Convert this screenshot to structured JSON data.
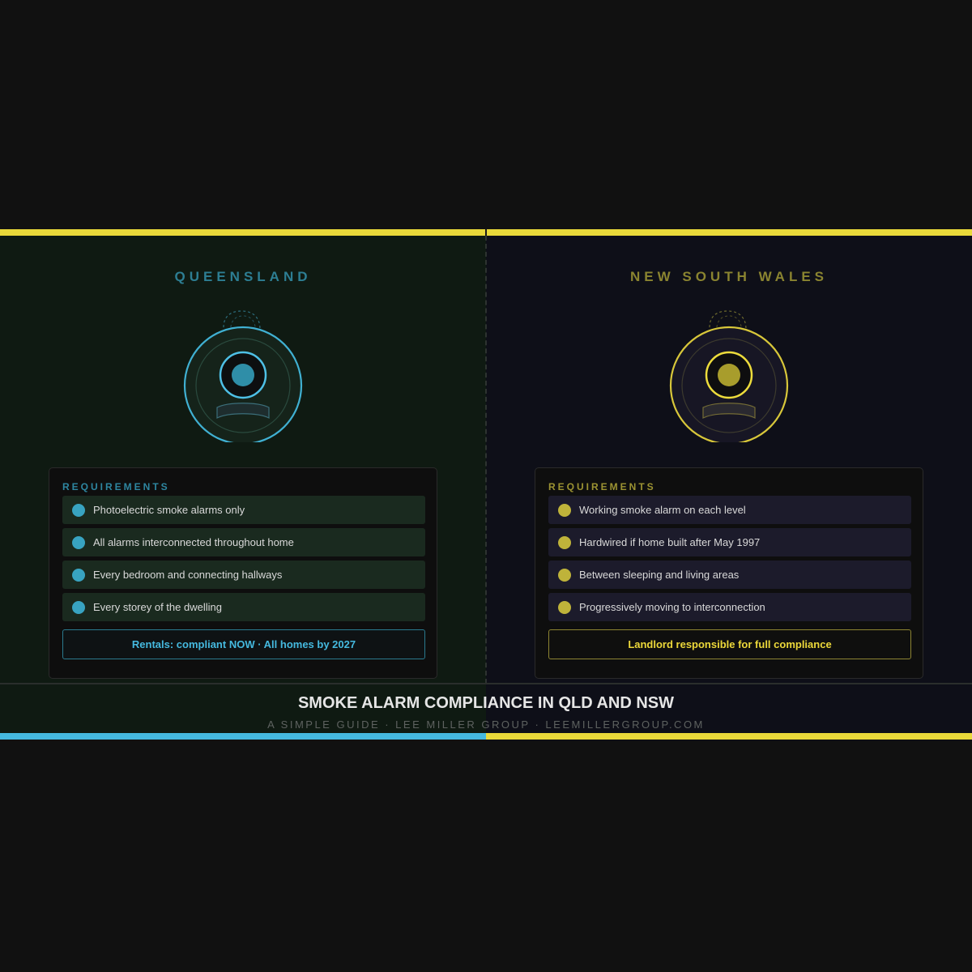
{
  "qld": {
    "title": "QUEENSLAND",
    "requirements_heading": "REQUIREMENTS",
    "requirements": [
      "Photoelectric smoke alarms only",
      "All alarms interconnected throughout home",
      "Every bedroom and connecting hallways",
      "Every storey of the dwelling"
    ],
    "callout": "Rentals: compliant NOW · All homes by 2027",
    "accent": "#45b9df"
  },
  "nsw": {
    "title": "NEW SOUTH WALES",
    "requirements_heading": "REQUIREMENTS",
    "requirements": [
      "Working smoke alarm on each level",
      "Hardwired if home built after May 1997",
      "Between sleeping and living areas",
      "Progressively moving to interconnection"
    ],
    "callout": "Landlord responsible for full compliance",
    "accent": "#e9d93a"
  },
  "footer": {
    "title": "SMOKE ALARM COMPLIANCE IN QLD AND NSW",
    "subtitle": "A SIMPLE GUIDE · LEE MILLER GROUP · LEEMILLERGROUP.COM"
  },
  "icons": {
    "qld_alarm": "smoke-alarm-icon",
    "nsw_alarm": "smoke-alarm-icon",
    "bullet": "dot-icon"
  }
}
